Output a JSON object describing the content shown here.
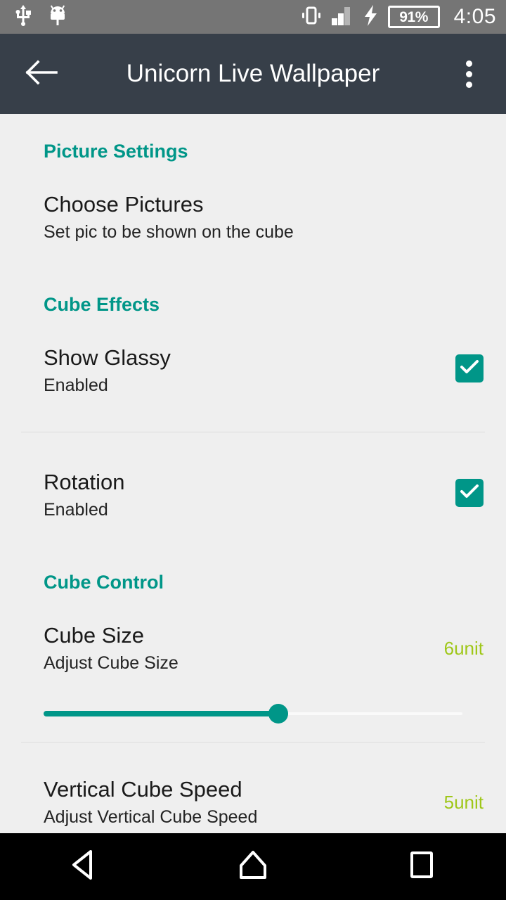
{
  "status_bar": {
    "icons": [
      "usb-icon",
      "android-debug-icon",
      "vibrate-icon",
      "signal-icon",
      "charging-bolt-icon"
    ],
    "battery_percent": "91%",
    "clock": "4:05",
    "background_color": "#757575",
    "foreground_color": "#FFFFFF"
  },
  "app_bar": {
    "title": "Unicorn Live Wallpaper",
    "back_icon": "arrow-left-icon",
    "overflow_icon": "more-vertical-icon",
    "background_color": "#373F49",
    "title_color": "#FFFFFF"
  },
  "theme": {
    "accent_teal": "#009688",
    "value_lime": "#9FC719",
    "page_background": "#EFEFEF",
    "divider": "#DCDCDC",
    "primary_text": "#1A1A1A",
    "secondary_text": "#232323"
  },
  "sections": [
    {
      "header": "Picture Settings",
      "items": [
        {
          "title": "Choose Pictures",
          "summary": "Set pic to be shown on the cube",
          "type": "plain"
        }
      ]
    },
    {
      "header": "Cube Effects",
      "items": [
        {
          "title": "Show Glassy",
          "summary": "Enabled",
          "type": "checkbox",
          "checked": true
        },
        {
          "title": "Rotation",
          "summary": "Enabled",
          "type": "checkbox",
          "checked": true
        }
      ]
    },
    {
      "header": "Cube Control",
      "items": [
        {
          "title": "Cube Size",
          "summary": "Adjust Cube Size",
          "type": "slider",
          "value_label": "6unit",
          "slider_percent": 56
        },
        {
          "title": "Vertical Cube Speed",
          "summary": "Adjust Vertical Cube Speed",
          "type": "slider-partial",
          "value_label": "5unit"
        }
      ]
    }
  ],
  "nav_bar": {
    "back_label": "back-icon",
    "home_label": "home-icon",
    "recents_label": "recents-icon",
    "background_color": "#000000"
  }
}
